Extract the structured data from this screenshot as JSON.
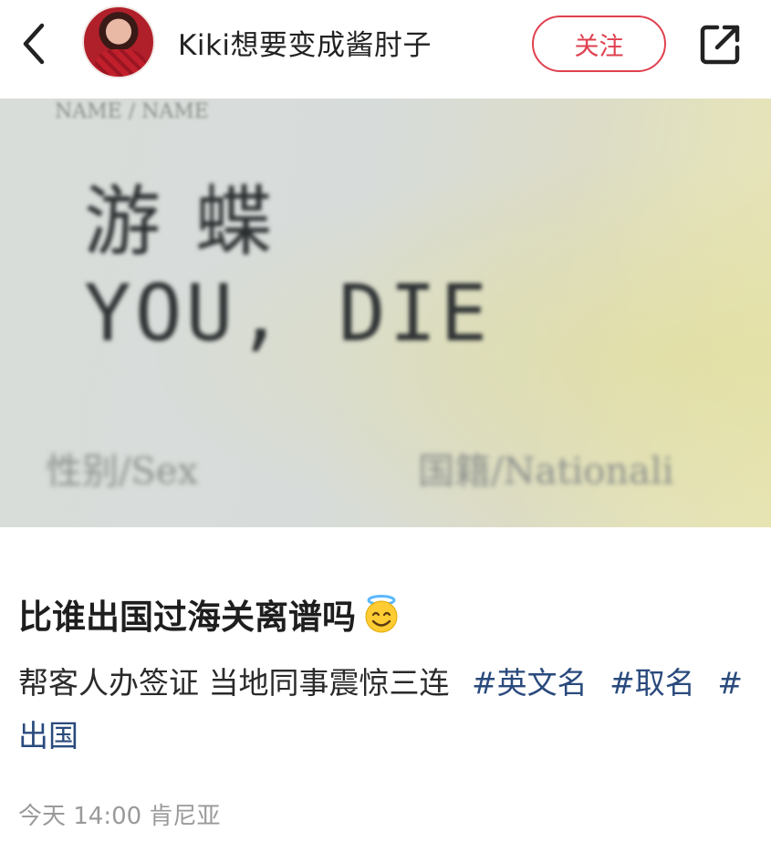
{
  "header": {
    "username": "Kiki想要变成酱肘子",
    "follow_label": "关注"
  },
  "photo": {
    "faint_top_text": "NAME / NAME",
    "cn_name": "游蝶",
    "en_name": "YOU, DIE",
    "sex_label": "性别/Sex",
    "nationality_label": "国籍/Nationali"
  },
  "post": {
    "title": "比谁出国过海关离谱吗",
    "body": "帮客人办签证 当地同事震惊三连",
    "tags": [
      "#英文名",
      "#取名",
      "#出国"
    ]
  },
  "meta": {
    "time_location": "今天 14:00 肯尼亚"
  },
  "colors": {
    "accent": "#e0404f",
    "tag": "#2a4a7d",
    "meta": "#9a9a9a"
  },
  "icons": {
    "back": "chevron-left-icon",
    "share": "share-icon",
    "emoji": "smiling-face-with-halo-emoji"
  }
}
